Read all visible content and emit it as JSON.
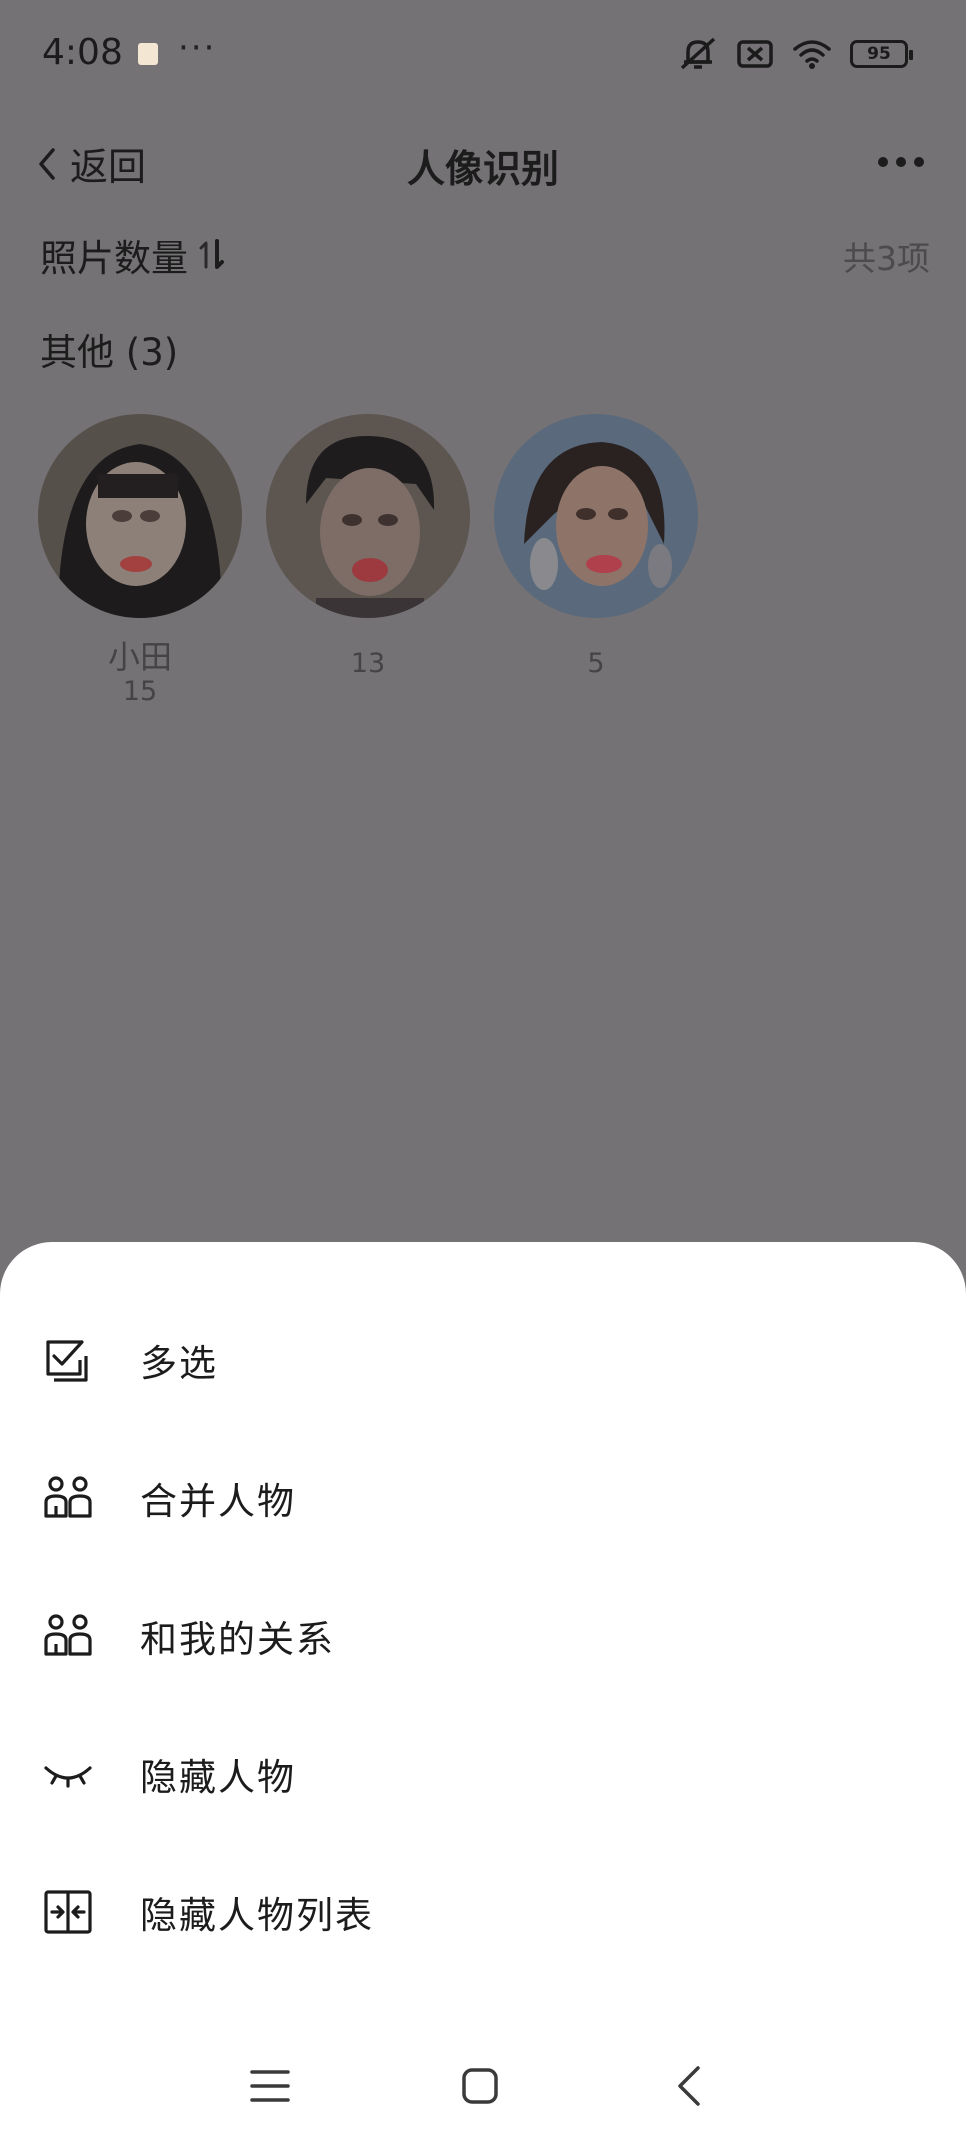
{
  "status_bar": {
    "time": "4:08",
    "dots": "···",
    "battery": "95",
    "icons": [
      "notification-app-icon",
      "mute-icon",
      "no-sim-icon",
      "wifi-icon",
      "battery-icon"
    ]
  },
  "nav": {
    "back_label": "返回",
    "title": "人像识别",
    "more_icon": "more-dots-icon"
  },
  "sort": {
    "label": "照片数量",
    "total": "共3项"
  },
  "section": {
    "title": "其他 (3)"
  },
  "people": [
    {
      "name": "小田",
      "count": "15"
    },
    {
      "name": "",
      "count": "13"
    },
    {
      "name": "",
      "count": "5"
    }
  ],
  "menu": {
    "items": [
      {
        "label": "多选",
        "icon": "multi-select-icon"
      },
      {
        "label": "合并人物",
        "icon": "merge-people-icon"
      },
      {
        "label": "和我的关系",
        "icon": "relationship-icon"
      },
      {
        "label": "隐藏人物",
        "icon": "hide-eye-icon"
      },
      {
        "label": "隐藏人物列表",
        "icon": "hidden-list-icon"
      }
    ]
  },
  "system_nav": {
    "icons": [
      "menu-icon",
      "home-icon",
      "back-icon"
    ]
  },
  "colors": {
    "scrim": "#757275",
    "sheet": "#ffffff",
    "text": "#1c1c1c"
  }
}
